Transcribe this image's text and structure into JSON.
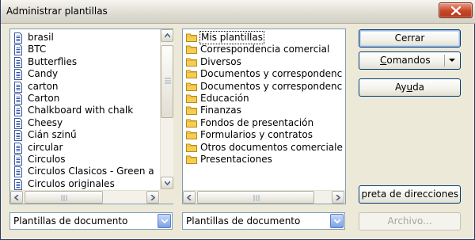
{
  "window": {
    "title": "Administrar plantillas"
  },
  "left_list": {
    "items": [
      "brasil",
      "BTC",
      "Butterflies",
      "Candy",
      "carton",
      "Carton",
      "Chalkboard with chalk",
      "Cheesy",
      "Cián szinű",
      "circular",
      "Circulos",
      "Circulos Clasicos - Green a",
      "Circulos originales"
    ],
    "icon": "document-icon"
  },
  "right_list": {
    "items": [
      "Mis plantillas",
      "Correspondencia comercial",
      "Diversos",
      "Documentos y correspondenc",
      "Documentos y correspondenc",
      "Educación",
      "Finanzas",
      "Fondos de presentación",
      "Formularios y contratos",
      "Otros documentos comerciale",
      "Presentaciones"
    ],
    "selected_index": 0,
    "icon": "folder-icon"
  },
  "left_combo": {
    "value": "Plantillas de documento"
  },
  "right_combo": {
    "value": "Plantillas de documento"
  },
  "buttons": {
    "close": "Cerrar",
    "commands_pre": "",
    "commands_u": "C",
    "commands_post": "omandos",
    "help_pre": "Ay",
    "help_u": "u",
    "help_post": "da",
    "address_book": "preta de direcciones",
    "file": "Archivo..."
  },
  "colors": {
    "accent_blue": "#316ac5",
    "folder_yellow": "#f2c94c",
    "disabled_text": "#a8a697"
  }
}
